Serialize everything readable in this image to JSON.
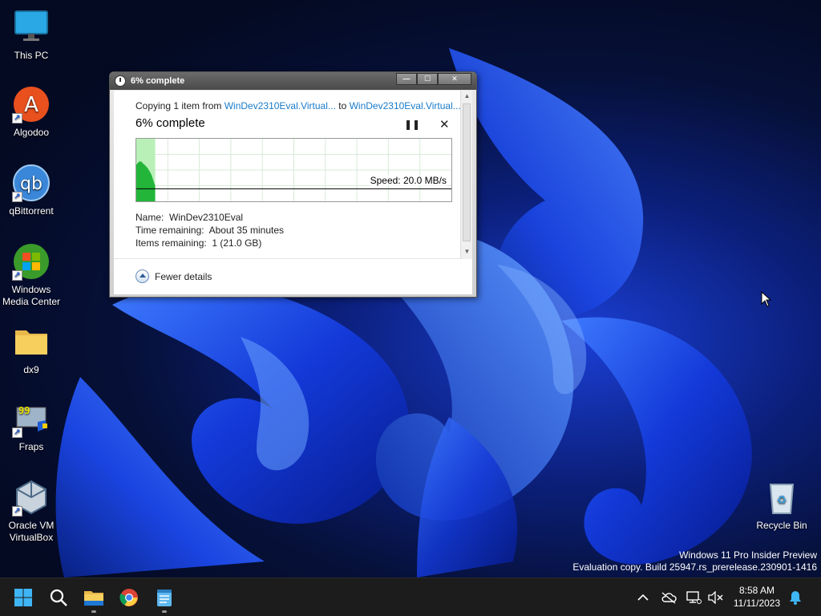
{
  "desktop": {
    "icons": [
      {
        "label": "This PC",
        "icon": "monitor-icon",
        "shortcut": false
      },
      {
        "label": "Algodoo",
        "icon": "algodoo-icon",
        "shortcut": true
      },
      {
        "label": "qBittorrent",
        "icon": "qbittorrent-icon",
        "shortcut": true
      },
      {
        "label": "Windows Media Center",
        "icon": "windows-media-center-icon",
        "shortcut": true
      },
      {
        "label": "dx9",
        "icon": "folder-icon",
        "shortcut": false
      },
      {
        "label": "Fraps",
        "icon": "fraps-icon",
        "shortcut": true
      },
      {
        "label": "Oracle VM VirtualBox",
        "icon": "virtualbox-icon",
        "shortcut": true
      }
    ],
    "recycle_bin": {
      "label": "Recycle Bin",
      "icon": "recycle-bin-icon"
    },
    "watermark": {
      "line1": "Windows 11 Pro Insider Preview",
      "line2": "Evaluation copy. Build 25947.rs_prerelease.230901-1416"
    }
  },
  "copy_dialog": {
    "title": "6% complete",
    "copy_prefix": "Copying 1 item from ",
    "source": "WinDev2310Eval.Virtual...",
    "to_word": " to ",
    "destination": "WinDev2310Eval.Virtual...",
    "heading": "6% complete",
    "progress_fraction": 0.06,
    "pause_glyph": "❚❚",
    "cancel_glyph": "✕",
    "speed": "Speed: 20.0 MB/s",
    "name_label": "Name:",
    "name_value": "WinDev2310Eval",
    "time_label": "Time remaining:",
    "time_value": "About 35 minutes",
    "items_label": "Items remaining:",
    "items_value": "1 (21.0 GB)",
    "fewer_details": "Fewer details",
    "window_buttons": {
      "minimize": "—",
      "maximize": "☐",
      "close": "✕"
    },
    "colors": {
      "progress_fill": "#22b53a",
      "progress_bg": "#b8f0b8",
      "grid": "#d8ead8",
      "link": "#1a7bc9"
    }
  },
  "taskbar": {
    "apps": [
      {
        "name": "start-button",
        "icon": "windows-logo-icon"
      },
      {
        "name": "search-button",
        "icon": "search-icon"
      },
      {
        "name": "file-explorer-button",
        "icon": "folder-icon"
      },
      {
        "name": "chrome-button",
        "icon": "chrome-icon"
      },
      {
        "name": "notepad-button",
        "icon": "notepad-icon"
      }
    ],
    "tray": {
      "icons": [
        "chevron-up-icon",
        "cloud-offline-icon",
        "network-icon",
        "volume-muted-icon"
      ],
      "time": "8:58 AM",
      "date": "11/11/2023",
      "notification_icon": "bell-icon"
    }
  }
}
